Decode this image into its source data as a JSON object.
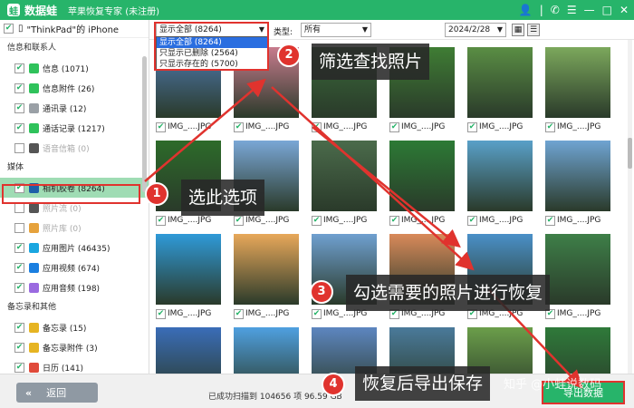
{
  "app": {
    "name": "数据蛙",
    "subtitle": "苹果恢复专家 (未注册)",
    "logo_letter": "蛙"
  },
  "window_controls": [
    "👤",
    "|",
    "✆",
    "☰",
    "—",
    "□",
    "✕"
  ],
  "device": {
    "label": "\"ThinkPad\"的 iPhone",
    "icon": "phone-icon"
  },
  "sidebar": {
    "sections": [
      {
        "title": "信息和联系人",
        "items": [
          {
            "label": "信息 (1071)",
            "checked": true,
            "color": "#2fc25b",
            "icon": "message-icon"
          },
          {
            "label": "信息附件 (26)",
            "checked": true,
            "color": "#2fc25b",
            "icon": "attachment-icon"
          },
          {
            "label": "通讯录 (12)",
            "checked": true,
            "color": "#9aa0a6",
            "icon": "contacts-icon"
          },
          {
            "label": "通话记录 (1217)",
            "checked": true,
            "color": "#2fc25b",
            "icon": "call-icon"
          },
          {
            "label": "语音信箱 (0)",
            "checked": false,
            "disabled": true,
            "color": "#555",
            "icon": "voicemail-icon"
          }
        ]
      },
      {
        "title": "媒体",
        "items": [
          {
            "label": "相机胶卷 (8264)",
            "checked": true,
            "selected": true,
            "color": "#1e5fa8",
            "icon": "camera-icon"
          },
          {
            "label": "照片流 (0)",
            "checked": false,
            "disabled": true,
            "color": "#555",
            "icon": "photostream-icon"
          },
          {
            "label": "照片库 (0)",
            "checked": false,
            "disabled": true,
            "color": "#e6a23c",
            "icon": "photo-library-icon"
          },
          {
            "label": "应用图片 (46435)",
            "checked": true,
            "color": "#1aa6e0",
            "icon": "app-photos-icon"
          },
          {
            "label": "应用视频 (674)",
            "checked": true,
            "color": "#1a7fe0",
            "icon": "app-video-icon"
          },
          {
            "label": "应用音频 (198)",
            "checked": true,
            "color": "#9a6ae0",
            "icon": "app-audio-icon"
          }
        ]
      },
      {
        "title": "备忘录和其他",
        "items": [
          {
            "label": "备忘录 (15)",
            "checked": true,
            "color": "#e6b422",
            "icon": "notes-icon"
          },
          {
            "label": "备忘录附件 (3)",
            "checked": true,
            "color": "#e6b422",
            "icon": "notes-attachment-icon"
          },
          {
            "label": "日历 (141)",
            "checked": true,
            "color": "#e04a3a",
            "icon": "calendar-icon"
          }
        ]
      }
    ]
  },
  "toolbar": {
    "filter_selected": "显示全部 (8264)",
    "type_label": "类型:",
    "type_value": "所有",
    "date_value": "2024/2/28",
    "arrow": "▼",
    "grid_view_icon": "▦",
    "list_view_icon": "☰"
  },
  "filter_options": [
    "显示全部 (8264)",
    "只显示已删除 (2564)",
    "只显示存在的 (5700)"
  ],
  "photo_caption": "IMG_....JPG",
  "photo_colors": [
    [
      "#4f7ab0",
      "#c77b8d",
      "#3a6a3a",
      "#3f7d34",
      "#5a8e44",
      "#7ca85c"
    ],
    [
      "#2d6b2a",
      "#7aa7d6",
      "#4b6b4b",
      "#2c7a35",
      "#59a0c8",
      "#6fa4d2"
    ],
    [
      "#2f9ad8",
      "#e8a85a",
      "#6fa0d0",
      "#d98a5a",
      "#4a90c8",
      "#3e7f48"
    ],
    [
      "#3a6db8",
      "#4fa0e0",
      "#5d86c0",
      "#4a7a9a",
      "#6b9e4a",
      "#2f7a3a"
    ]
  ],
  "bottom": {
    "back_label": "返回",
    "back_chevron": "«",
    "status_text": "已成功扫描到 104656 项 96.59 GB",
    "export_label": "导出数据",
    "watermark": "知乎 @小蛙说数码"
  },
  "annotations": [
    {
      "num": "1",
      "text": "选此选项"
    },
    {
      "num": "2",
      "text": "筛选查找照片"
    },
    {
      "num": "3",
      "text": "勾选需要的照片进行恢复"
    },
    {
      "num": "4",
      "text": "恢复后导出保存"
    }
  ],
  "colors": {
    "brand": "#27b46a",
    "highlight": "#e0332e",
    "selected_row": "#9fdcb4"
  }
}
